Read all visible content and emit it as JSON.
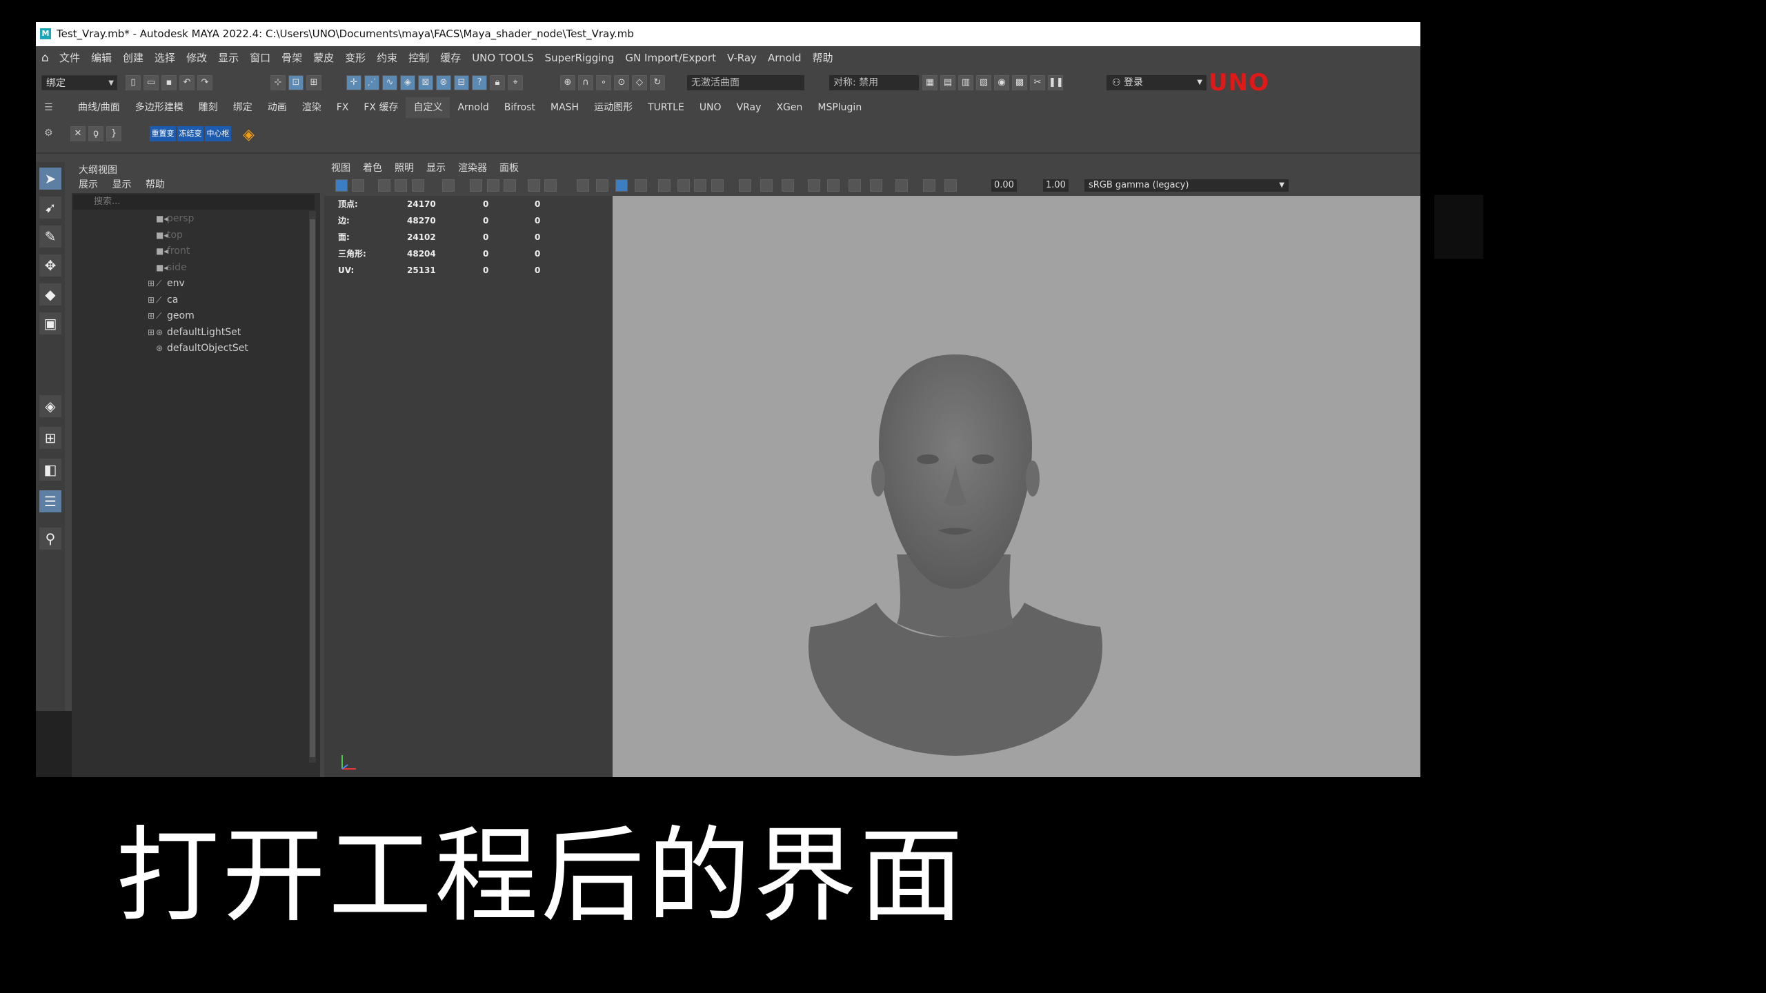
{
  "window": {
    "title": "Test_Vray.mb* - Autodesk MAYA 2022.4: C:\\Users\\UNO\\Documents\\maya\\FACS\\Maya_shader_node\\Test_Vray.mb",
    "logo": "M"
  },
  "menubar": {
    "home_icon": "home-icon",
    "items": [
      "文件",
      "编辑",
      "创建",
      "选择",
      "修改",
      "显示",
      "窗口",
      "骨架",
      "蒙皮",
      "变形",
      "约束",
      "控制",
      "缓存",
      "UNO TOOLS",
      "SuperRigging",
      "GN Import/Export",
      "V-Ray",
      "Arnold",
      "帮助"
    ]
  },
  "statusline": {
    "mode": "绑定",
    "live_surface": "无激活曲面",
    "symmetry": "对称: 禁用",
    "login": "登录",
    "brand": "UNO"
  },
  "shelf": {
    "tabs": [
      "曲线/曲面",
      "多边形建模",
      "雕刻",
      "绑定",
      "动画",
      "渲染",
      "FX",
      "FX 缓存",
      "自定义",
      "Arnold",
      "Bifrost",
      "MASH",
      "运动图形",
      "TURTLE",
      "UNO",
      "VRay",
      "XGen",
      "MSPlugin"
    ],
    "active_tab": "自定义",
    "shelf_buttons": [
      "重置变",
      "冻结变",
      "中心枢"
    ]
  },
  "outliner": {
    "title": "大纲视图",
    "menu": [
      "展示",
      "显示",
      "帮助"
    ],
    "search_placeholder": "搜索...",
    "items": [
      {
        "label": "persp",
        "type": "camera",
        "expandable": false,
        "dim": true
      },
      {
        "label": "top",
        "type": "camera",
        "expandable": false,
        "dim": true
      },
      {
        "label": "front",
        "type": "camera",
        "expandable": false,
        "dim": true
      },
      {
        "label": "side",
        "type": "camera",
        "expandable": false,
        "dim": true
      },
      {
        "label": "env",
        "type": "group",
        "expandable": true,
        "dim": false
      },
      {
        "label": "ca",
        "type": "group",
        "expandable": true,
        "dim": false
      },
      {
        "label": "geom",
        "type": "group",
        "expandable": true,
        "dim": false
      },
      {
        "label": "defaultLightSet",
        "type": "set",
        "expandable": true,
        "dim": false
      },
      {
        "label": "defaultObjectSet",
        "type": "set",
        "expandable": false,
        "dim": false
      }
    ]
  },
  "viewport": {
    "menu": [
      "视图",
      "着色",
      "照明",
      "显示",
      "渲染器",
      "面板"
    ],
    "exposure": "0.00",
    "gamma": "1.00",
    "color_space": "sRGB gamma (legacy)",
    "hud": [
      {
        "label": "顶点:",
        "a": "24170",
        "b": "0",
        "c": "0"
      },
      {
        "label": "边:",
        "a": "48270",
        "b": "0",
        "c": "0"
      },
      {
        "label": "面:",
        "a": "24102",
        "b": "0",
        "c": "0"
      },
      {
        "label": "三角形:",
        "a": "48204",
        "b": "0",
        "c": "0"
      },
      {
        "label": "UV:",
        "a": "25131",
        "b": "0",
        "c": "0"
      }
    ]
  },
  "caption": "打开工程后的界面"
}
